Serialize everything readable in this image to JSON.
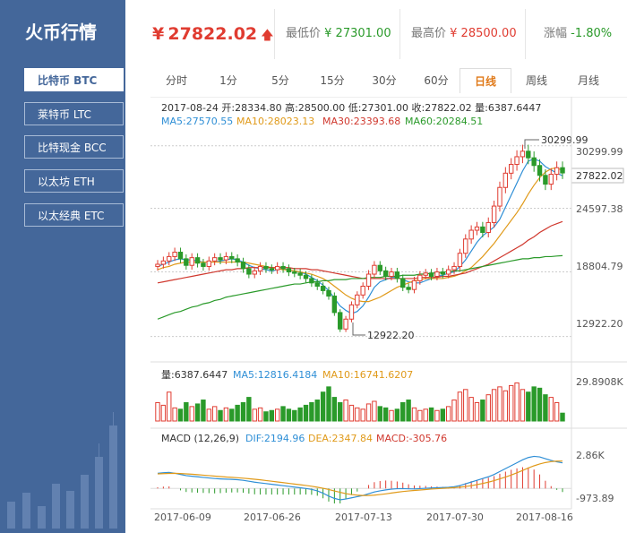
{
  "sidebar": {
    "brand": "火币行情",
    "items": [
      {
        "label": "比特币 BTC",
        "active": true
      },
      {
        "label": "莱特币 LTC",
        "active": false
      },
      {
        "label": "比特现金 BCC",
        "active": false
      },
      {
        "label": "以太坊 ETH",
        "active": false
      },
      {
        "label": "以太经典 ETC",
        "active": false
      }
    ]
  },
  "header": {
    "currency": "¥",
    "price": "27822.02",
    "low_label": "最低价",
    "low_value": "¥ 27301.00",
    "high_label": "最高价",
    "high_value": "¥ 28500.00",
    "change_label": "涨幅",
    "change_value": "-1.80%",
    "colors": {
      "up": "#e03c31",
      "down": "#2a9a2a"
    }
  },
  "tabs": [
    "分时",
    "1分",
    "5分",
    "15分",
    "30分",
    "60分",
    "日线",
    "周线",
    "月线"
  ],
  "active_tab": "日线",
  "panels": {
    "kline_info_line1": "2017-08-24  开:28334.80 高:28500.00 低:27301.00 收:27822.02 量:6387.6447",
    "ma5": "MA5:27570.55",
    "ma10": "MA10:28023.13",
    "ma30": "MA30:23393.68",
    "ma60": "MA60:20284.51",
    "vol_label": "量:6387.6447",
    "vol_ma5": "MA5:12816.4184",
    "vol_ma10": "MA10:16741.6207",
    "macd_label": "MACD (12,26,9)",
    "dif": "DIF:2194.96",
    "dea": "DEA:2347.84",
    "macd": "MACD:-305.76"
  },
  "chart_data": {
    "type": "candlestick",
    "price_axis": [
      "30299.99",
      "24597.38",
      "18804.79",
      "12922.20"
    ],
    "current_price_tag": "27822.02",
    "max_annotation": "30299.99",
    "min_annotation": "12922.20",
    "volume_axis": [
      "29.8908K"
    ],
    "macd_axis": [
      "2.86K",
      "-973.89"
    ],
    "dates": [
      "2017-06-09",
      "2017-06-26",
      "2017-07-13",
      "2017-07-30",
      "2017-08-16"
    ],
    "closes": [
      19500,
      19800,
      20200,
      20600,
      20000,
      19400,
      20100,
      19600,
      19300,
      19800,
      20100,
      19900,
      20200,
      20000,
      19700,
      19100,
      18600,
      18900,
      19300,
      19100,
      19000,
      19300,
      19100,
      18800,
      18700,
      18500,
      18200,
      17800,
      17500,
      17100,
      16600,
      15100,
      13600,
      14500,
      15800,
      16700,
      17500,
      18600,
      19400,
      18900,
      18400,
      18800,
      18200,
      17400,
      17200,
      18000,
      18500,
      18700,
      18400,
      18800,
      18600,
      19000,
      19300,
      20500,
      21800,
      22600,
      22900,
      22400,
      23300,
      24800,
      26500,
      27800,
      28600,
      29300,
      29800,
      29200,
      28500,
      27600,
      26800,
      27700,
      28300,
      27822
    ],
    "ma5": [
      19300,
      19500,
      19700,
      19900,
      20000,
      19900,
      19900,
      19800,
      19700,
      19700,
      19700,
      19800,
      19900,
      20000,
      19900,
      19700,
      19400,
      19200,
      19100,
      19000,
      18900,
      19000,
      19100,
      19000,
      18900,
      18800,
      18600,
      18300,
      18000,
      17600,
      17100,
      16400,
      15700,
      15300,
      15000,
      15200,
      15700,
      16500,
      17400,
      17900,
      18100,
      18300,
      18300,
      18100,
      17900,
      17800,
      17800,
      18000,
      18200,
      18400,
      18500,
      18700,
      18800,
      19300,
      19900,
      20700,
      21500,
      22100,
      22500,
      22900,
      23600,
      24700,
      25800,
      26900,
      28000,
      28900,
      29100,
      28900,
      28400,
      28100,
      27800,
      27570
    ],
    "ma10": [
      19000,
      19200,
      19300,
      19500,
      19600,
      19700,
      19700,
      19700,
      19700,
      19700,
      19700,
      19700,
      19700,
      19700,
      19700,
      19700,
      19600,
      19500,
      19400,
      19300,
      19200,
      19100,
      19000,
      19000,
      18900,
      18800,
      18700,
      18600,
      18400,
      18200,
      17900,
      17500,
      17100,
      16700,
      16400,
      16200,
      16100,
      16100,
      16300,
      16500,
      16800,
      17100,
      17400,
      17600,
      17800,
      18000,
      18100,
      18200,
      18200,
      18200,
      18200,
      18300,
      18400,
      18600,
      18900,
      19200,
      19700,
      20200,
      20800,
      21400,
      22100,
      22800,
      23500,
      24200,
      25000,
      25900,
      26700,
      27400,
      27900,
      28200,
      28300,
      28023
    ],
    "ma30": [
      17800,
      17900,
      18000,
      18100,
      18200,
      18300,
      18400,
      18500,
      18600,
      18700,
      18800,
      18900,
      19000,
      19000,
      19100,
      19100,
      19200,
      19200,
      19200,
      19200,
      19200,
      19200,
      19200,
      19200,
      19100,
      19100,
      19100,
      19000,
      19000,
      18900,
      18800,
      18700,
      18600,
      18500,
      18400,
      18300,
      18200,
      18200,
      18200,
      18200,
      18200,
      18200,
      18200,
      18200,
      18200,
      18200,
      18300,
      18300,
      18300,
      18300,
      18400,
      18400,
      18500,
      18600,
      18700,
      18900,
      19100,
      19300,
      19500,
      19800,
      20100,
      20400,
      20700,
      21000,
      21300,
      21700,
      22000,
      22400,
      22700,
      23000,
      23200,
      23393
    ],
    "ma60": [
      14500,
      14700,
      14900,
      15100,
      15200,
      15400,
      15600,
      15700,
      15900,
      16000,
      16200,
      16300,
      16500,
      16600,
      16700,
      16800,
      16900,
      17000,
      17100,
      17200,
      17300,
      17400,
      17500,
      17600,
      17700,
      17700,
      17800,
      17900,
      17900,
      18000,
      18000,
      18100,
      18100,
      18100,
      18200,
      18200,
      18200,
      18300,
      18300,
      18300,
      18400,
      18400,
      18400,
      18500,
      18500,
      18500,
      18600,
      18600,
      18700,
      18700,
      18800,
      18800,
      18900,
      18900,
      19000,
      19100,
      19200,
      19300,
      19400,
      19500,
      19600,
      19700,
      19800,
      19900,
      20000,
      20000,
      20100,
      20100,
      20200,
      20200,
      20250,
      20284
    ],
    "volumes": [
      14,
      12,
      22,
      10,
      9,
      14,
      11,
      13,
      16,
      9,
      11,
      8,
      10,
      9,
      12,
      14,
      18,
      9,
      10,
      7,
      8,
      9,
      11,
      9,
      8,
      10,
      12,
      14,
      16,
      22,
      26,
      18,
      14,
      16,
      12,
      10,
      9,
      13,
      15,
      11,
      10,
      8,
      9,
      14,
      16,
      10,
      8,
      9,
      10,
      8,
      9,
      11,
      16,
      22,
      24,
      18,
      14,
      16,
      20,
      24,
      26,
      23,
      27,
      29,
      24,
      22,
      26,
      25,
      20,
      18,
      14,
      6
    ],
    "dif": [
      1300,
      1350,
      1380,
      1300,
      1200,
      1100,
      1050,
      1000,
      950,
      900,
      850,
      820,
      800,
      780,
      750,
      700,
      620,
      540,
      480,
      420,
      360,
      300,
      240,
      180,
      120,
      60,
      0,
      -80,
      -200,
      -400,
      -650,
      -850,
      -970,
      -900,
      -800,
      -700,
      -600,
      -450,
      -300,
      -200,
      -120,
      -60,
      -20,
      -10,
      -30,
      -40,
      -10,
      20,
      40,
      60,
      80,
      100,
      150,
      250,
      400,
      550,
      700,
      850,
      1000,
      1200,
      1450,
      1700,
      1950,
      2200,
      2450,
      2650,
      2750,
      2700,
      2550,
      2400,
      2280,
      2195
    ],
    "dea": [
      1250,
      1270,
      1290,
      1300,
      1280,
      1250,
      1220,
      1180,
      1140,
      1100,
      1060,
      1020,
      980,
      950,
      920,
      880,
      840,
      790,
      740,
      680,
      620,
      560,
      500,
      440,
      380,
      320,
      260,
      190,
      110,
      20,
      -90,
      -210,
      -330,
      -440,
      -520,
      -570,
      -600,
      -600,
      -570,
      -520,
      -460,
      -390,
      -320,
      -260,
      -210,
      -170,
      -130,
      -90,
      -50,
      -20,
      10,
      40,
      70,
      110,
      170,
      240,
      330,
      430,
      540,
      670,
      820,
      980,
      1150,
      1340,
      1540,
      1750,
      1940,
      2100,
      2220,
      2300,
      2340,
      2348
    ]
  }
}
